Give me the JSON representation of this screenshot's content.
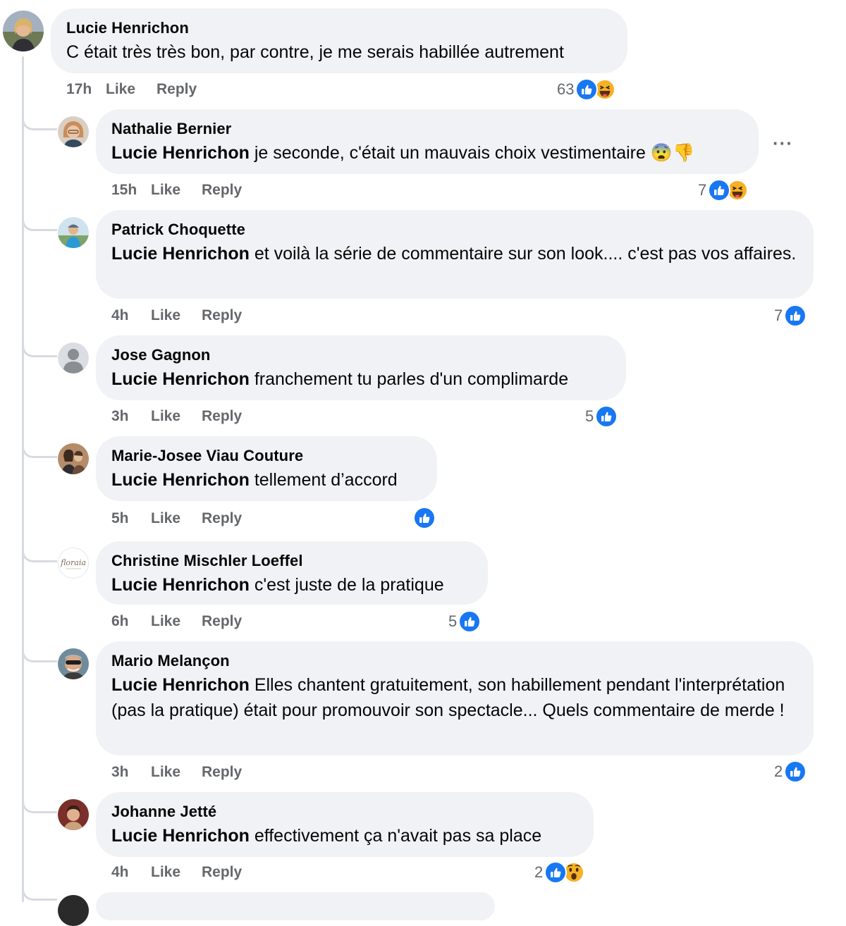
{
  "comments": [
    {
      "author": "Lucie Henrichon",
      "mention": "",
      "text": "C était très très bon, par contre, je me serais habillée autrement",
      "time": "17h",
      "like": "Like",
      "reply": "Reply",
      "reaction_count": "63",
      "reactions": [
        "like",
        "haha"
      ]
    },
    {
      "author": "Nathalie Bernier",
      "mention": "Lucie Henrichon",
      "text": " je seconde, c'était un mauvais choix vestimentaire 😨👎",
      "time": "15h",
      "like": "Like",
      "reply": "Reply",
      "reaction_count": "7",
      "reactions": [
        "like",
        "haha"
      ]
    },
    {
      "author": "Patrick Choquette",
      "mention": "Lucie Henrichon",
      "text": " et voilà la série de commentaire sur son look.... c'est pas vos affaires.",
      "time": "4h",
      "like": "Like",
      "reply": "Reply",
      "reaction_count": "7",
      "reactions": [
        "like"
      ]
    },
    {
      "author": "Jose Gagnon",
      "mention": "Lucie Henrichon",
      "text": " franchement tu parles d'un complimarde",
      "time": "3h",
      "like": "Like",
      "reply": "Reply",
      "reaction_count": "5",
      "reactions": [
        "like"
      ]
    },
    {
      "author": "Marie-Josee Viau Couture",
      "mention": "Lucie Henrichon",
      "text": " tellement d’accord",
      "time": "5h",
      "like": "Like",
      "reply": "Reply",
      "reaction_count": "",
      "reactions": [
        "like"
      ]
    },
    {
      "author": "Christine Mischler Loeffel",
      "mention": "Lucie Henrichon",
      "text": " c'est juste de la pratique",
      "time": "6h",
      "like": "Like",
      "reply": "Reply",
      "reaction_count": "5",
      "reactions": [
        "like"
      ]
    },
    {
      "author": "Mario Melançon",
      "mention": "Lucie Henrichon",
      "text": " Elles chantent gratuitement, son habillement pendant l'interprétation (pas la pratique) était pour promouvoir son spectacle... Quels commentaire de merde !",
      "time": "3h",
      "like": "Like",
      "reply": "Reply",
      "reaction_count": "2",
      "reactions": [
        "like"
      ]
    },
    {
      "author": "Johanne Jetté",
      "mention": "Lucie Henrichon",
      "text": " effectivement ça n'avait pas sa place",
      "time": "4h",
      "like": "Like",
      "reply": "Reply",
      "reaction_count": "2",
      "reactions": [
        "like",
        "wow"
      ]
    }
  ],
  "more_options": "···",
  "colors": {
    "bubble": "#f0f2f5",
    "like_blue": "#1877f2",
    "meta": "#65676b",
    "thread_line": "#d7dbe0"
  }
}
